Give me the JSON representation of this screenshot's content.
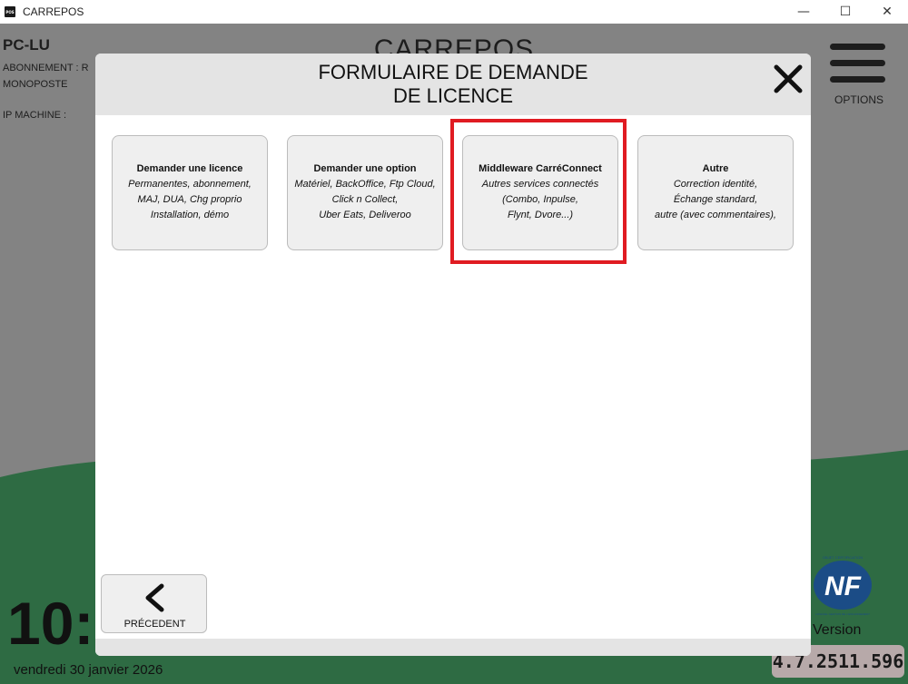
{
  "window": {
    "title": "CARREPOS",
    "icon_text": "POS",
    "minimize_glyph": "—",
    "maximize_glyph": "☐",
    "close_glyph": "✕"
  },
  "background_app": {
    "pc_name": "PC-LU",
    "subscription_label": "ABONNEMENT : R",
    "license_type": "MONOPOSTE",
    "ip_label": "IP MACHINE :",
    "app_title": "CARREPOS",
    "options_label": "OPTIONS",
    "clock_partial": "10:",
    "date": "vendredi 30 janvier 2026",
    "version_label": "Version",
    "version_value": "4.7.2511.596",
    "nf_logo_text": "NF",
    "nf_logo_top": "OBJET CERTIFICATION",
    "nf_logo_bottom": "LOGICIEL GESTION DE L'ENCAISSEMENT",
    "colors": {
      "green": "#2e7d47",
      "gray": "#838383"
    }
  },
  "modal": {
    "title_line1": "FORMULAIRE DE DEMANDE",
    "title_line2": "DE LICENCE",
    "close_icon": "close-icon",
    "cards": [
      {
        "title": "Demander une licence",
        "lines": [
          "Permanentes, abonnement,",
          "MAJ, DUA, Chg proprio",
          "Installation, démo"
        ]
      },
      {
        "title": "Demander une option",
        "lines": [
          "Matériel, BackOffice, Ftp Cloud,",
          "Click n Collect,",
          "Uber Eats, Deliveroo"
        ]
      },
      {
        "title": "Middleware CarréConnect",
        "lines": [
          "Autres services connectés",
          "(Combo, Inpulse,",
          "Flynt, Dvore...)"
        ]
      },
      {
        "title": "Autre",
        "lines": [
          "Correction identité,",
          "Échange standard,",
          "autre (avec commentaires),"
        ]
      }
    ],
    "back_label": "PRÉCEDENT",
    "highlight_color": "#e01b22"
  }
}
